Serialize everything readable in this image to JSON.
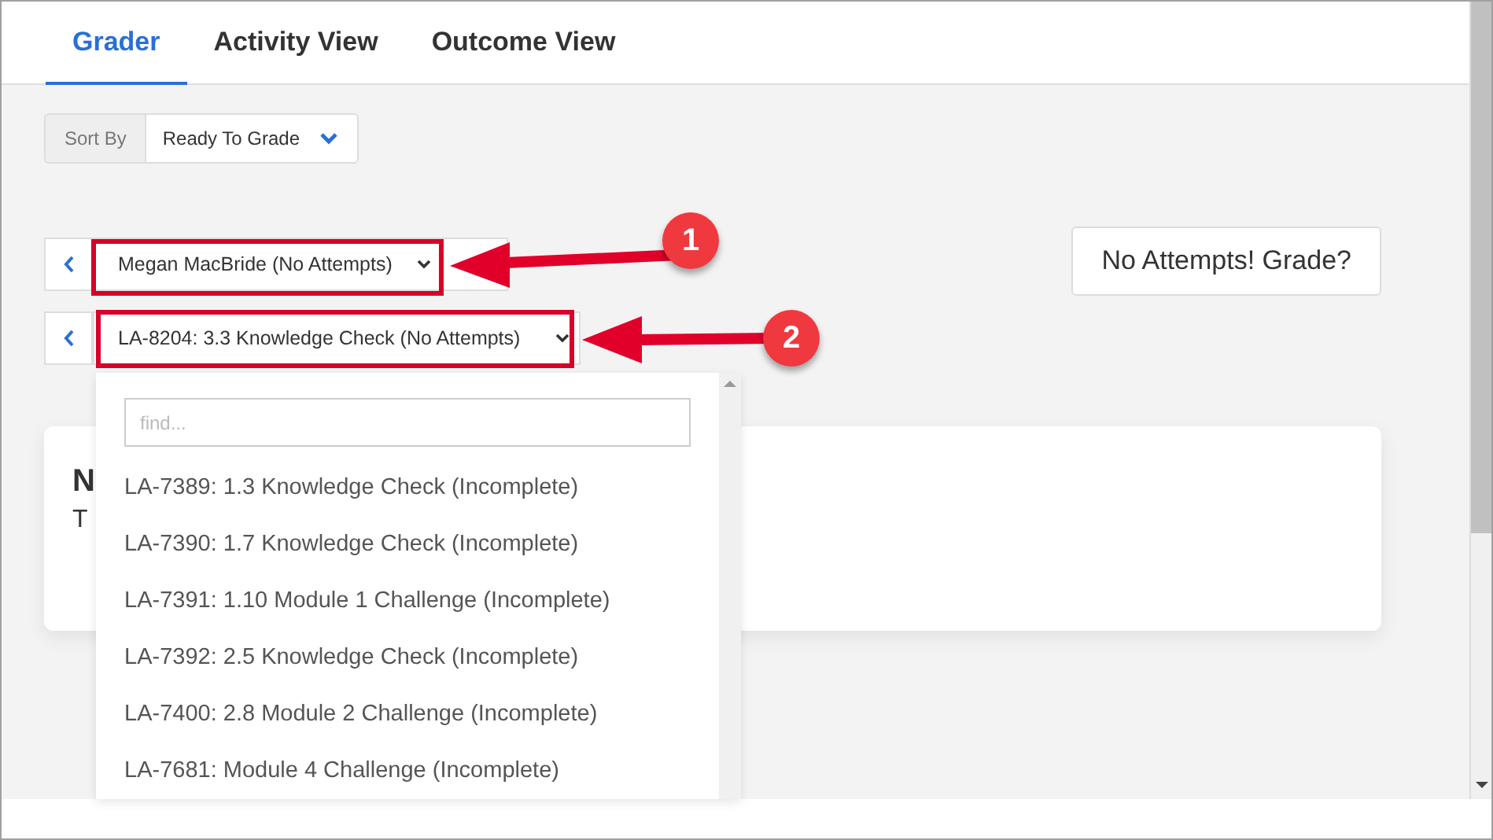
{
  "tabs": [
    {
      "label": "Grader",
      "selected": true
    },
    {
      "label": "Activity View",
      "selected": false
    },
    {
      "label": "Outcome View",
      "selected": false
    }
  ],
  "sort": {
    "label": "Sort By",
    "value": "Ready To Grade"
  },
  "learner_select": {
    "value": "Megan MacBride (No Attempts)"
  },
  "activity_select": {
    "value": "LA-8204: 3.3 Knowledge Check (No Attempts)"
  },
  "grade_button": "No Attempts! Grade?",
  "card": {
    "title": "N",
    "text": "T"
  },
  "dropdown": {
    "placeholder": "find...",
    "items": [
      "LA-7389: 1.3 Knowledge Check (Incomplete)",
      "LA-7390: 1.7 Knowledge Check (Incomplete)",
      "LA-7391: 1.10 Module 1 Challenge (Incomplete)",
      "LA-7392: 2.5 Knowledge Check (Incomplete)",
      "LA-7400: 2.8 Module 2 Challenge (Incomplete)",
      "LA-7681: Module 4 Challenge (Incomplete)"
    ]
  },
  "annotations": [
    "1",
    "2"
  ]
}
